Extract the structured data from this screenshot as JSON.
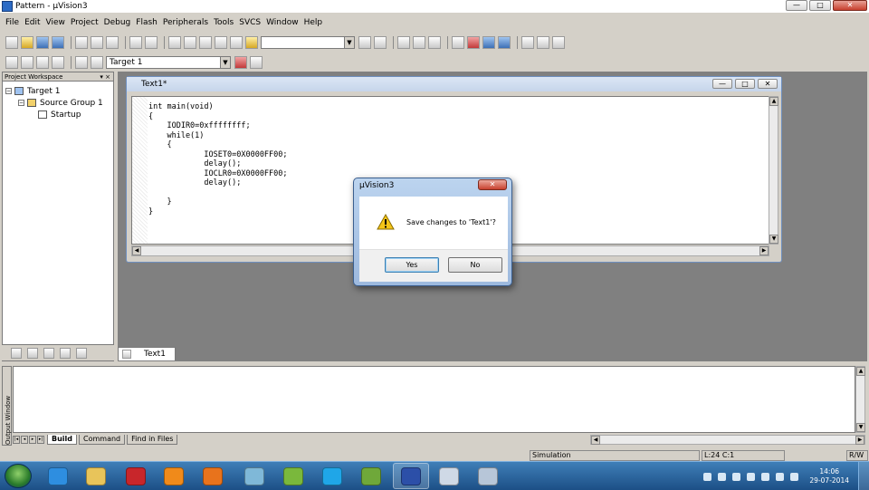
{
  "window": {
    "title": "Pattern - µVision3",
    "min": "—",
    "max": "□",
    "close": "✕"
  },
  "menu": [
    "File",
    "Edit",
    "View",
    "Project",
    "Debug",
    "Flash",
    "Peripherals",
    "Tools",
    "SVCS",
    "Window",
    "Help"
  ],
  "toolbar": {
    "find_value": "",
    "target_value": "Target 1",
    "combo_arrow": "▼"
  },
  "workspace": {
    "header": "Project Workspace",
    "header_buttons": "▾ ×",
    "tree": [
      {
        "label": "Target 1",
        "expander": "−"
      },
      {
        "label": "Source Group 1",
        "expander": "−"
      },
      {
        "label": "Startup"
      }
    ]
  },
  "editor": {
    "title": "Text1*",
    "buttons": [
      "—",
      "□",
      "✕"
    ],
    "code": "int main(void)\n{\n    IODIR0=0xffffffff;\n    while(1)\n    {\n            IOSET0=0X0000FF00;\n            delay();\n            IOCLR0=0X0000FF00;\n            delay();\n\n    }\n}"
  },
  "doc_tab": {
    "label": "Text1"
  },
  "output": {
    "vertical_label": "Output Window",
    "tabs": [
      "Build",
      "Command",
      "Find in Files"
    ],
    "nav": [
      "|◂",
      "◂",
      "▸",
      "▸|"
    ]
  },
  "status": {
    "mode": "Simulation",
    "position": "L:24 C:1",
    "rw": "R/W"
  },
  "dialog": {
    "title": "µVision3",
    "close": "✕",
    "message": "Save changes to 'Text1'?",
    "yes": "Yes",
    "no": "No"
  },
  "taskbar": {
    "apps": [
      {
        "name": "internet-explorer",
        "color": "#2e8ee0"
      },
      {
        "name": "file-explorer",
        "color": "#e8c45a"
      },
      {
        "name": "adobe-reader",
        "color": "#c8262b"
      },
      {
        "name": "vlc",
        "color": "#f08a1a"
      },
      {
        "name": "firefox",
        "color": "#e8731c"
      },
      {
        "name": "utility",
        "color": "#7fb8d8"
      },
      {
        "name": "bluestacks",
        "color": "#7ab83c"
      },
      {
        "name": "skype",
        "color": "#1fa6e8"
      },
      {
        "name": "bluestacks-2",
        "color": "#6fa83a"
      },
      {
        "name": "keil-uvision",
        "color": "#2c4fa8"
      },
      {
        "name": "paint-tool",
        "color": "#cfd9e6"
      },
      {
        "name": "window-app",
        "color": "#b7c6d8"
      }
    ],
    "clock_time": "14:06",
    "clock_date": "29-07-2014"
  }
}
